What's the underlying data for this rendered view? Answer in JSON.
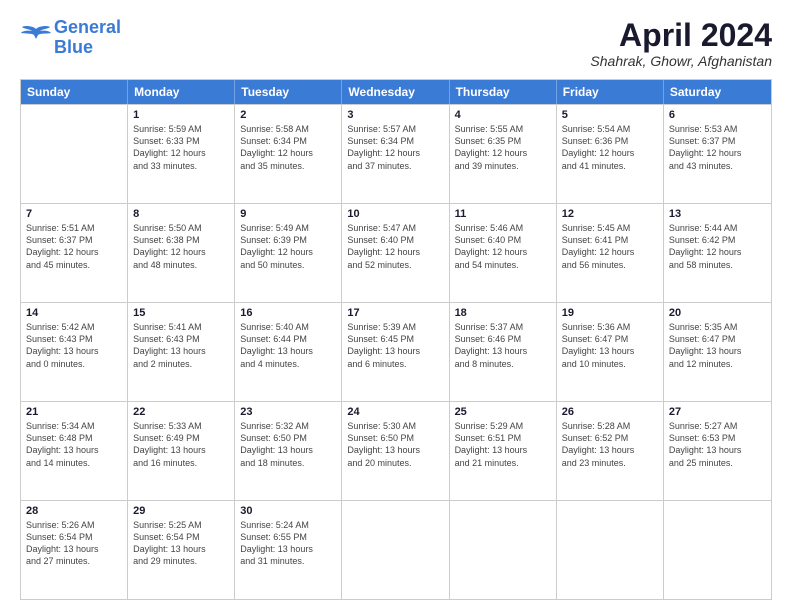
{
  "logo": {
    "line1": "General",
    "line2": "Blue"
  },
  "title": "April 2024",
  "subtitle": "Shahrak, Ghowr, Afghanistan",
  "days": [
    "Sunday",
    "Monday",
    "Tuesday",
    "Wednesday",
    "Thursday",
    "Friday",
    "Saturday"
  ],
  "weeks": [
    [
      {
        "day": "",
        "text": ""
      },
      {
        "day": "1",
        "text": "Sunrise: 5:59 AM\nSunset: 6:33 PM\nDaylight: 12 hours\nand 33 minutes."
      },
      {
        "day": "2",
        "text": "Sunrise: 5:58 AM\nSunset: 6:34 PM\nDaylight: 12 hours\nand 35 minutes."
      },
      {
        "day": "3",
        "text": "Sunrise: 5:57 AM\nSunset: 6:34 PM\nDaylight: 12 hours\nand 37 minutes."
      },
      {
        "day": "4",
        "text": "Sunrise: 5:55 AM\nSunset: 6:35 PM\nDaylight: 12 hours\nand 39 minutes."
      },
      {
        "day": "5",
        "text": "Sunrise: 5:54 AM\nSunset: 6:36 PM\nDaylight: 12 hours\nand 41 minutes."
      },
      {
        "day": "6",
        "text": "Sunrise: 5:53 AM\nSunset: 6:37 PM\nDaylight: 12 hours\nand 43 minutes."
      }
    ],
    [
      {
        "day": "7",
        "text": "Sunrise: 5:51 AM\nSunset: 6:37 PM\nDaylight: 12 hours\nand 45 minutes."
      },
      {
        "day": "8",
        "text": "Sunrise: 5:50 AM\nSunset: 6:38 PM\nDaylight: 12 hours\nand 48 minutes."
      },
      {
        "day": "9",
        "text": "Sunrise: 5:49 AM\nSunset: 6:39 PM\nDaylight: 12 hours\nand 50 minutes."
      },
      {
        "day": "10",
        "text": "Sunrise: 5:47 AM\nSunset: 6:40 PM\nDaylight: 12 hours\nand 52 minutes."
      },
      {
        "day": "11",
        "text": "Sunrise: 5:46 AM\nSunset: 6:40 PM\nDaylight: 12 hours\nand 54 minutes."
      },
      {
        "day": "12",
        "text": "Sunrise: 5:45 AM\nSunset: 6:41 PM\nDaylight: 12 hours\nand 56 minutes."
      },
      {
        "day": "13",
        "text": "Sunrise: 5:44 AM\nSunset: 6:42 PM\nDaylight: 12 hours\nand 58 minutes."
      }
    ],
    [
      {
        "day": "14",
        "text": "Sunrise: 5:42 AM\nSunset: 6:43 PM\nDaylight: 13 hours\nand 0 minutes."
      },
      {
        "day": "15",
        "text": "Sunrise: 5:41 AM\nSunset: 6:43 PM\nDaylight: 13 hours\nand 2 minutes."
      },
      {
        "day": "16",
        "text": "Sunrise: 5:40 AM\nSunset: 6:44 PM\nDaylight: 13 hours\nand 4 minutes."
      },
      {
        "day": "17",
        "text": "Sunrise: 5:39 AM\nSunset: 6:45 PM\nDaylight: 13 hours\nand 6 minutes."
      },
      {
        "day": "18",
        "text": "Sunrise: 5:37 AM\nSunset: 6:46 PM\nDaylight: 13 hours\nand 8 minutes."
      },
      {
        "day": "19",
        "text": "Sunrise: 5:36 AM\nSunset: 6:47 PM\nDaylight: 13 hours\nand 10 minutes."
      },
      {
        "day": "20",
        "text": "Sunrise: 5:35 AM\nSunset: 6:47 PM\nDaylight: 13 hours\nand 12 minutes."
      }
    ],
    [
      {
        "day": "21",
        "text": "Sunrise: 5:34 AM\nSunset: 6:48 PM\nDaylight: 13 hours\nand 14 minutes."
      },
      {
        "day": "22",
        "text": "Sunrise: 5:33 AM\nSunset: 6:49 PM\nDaylight: 13 hours\nand 16 minutes."
      },
      {
        "day": "23",
        "text": "Sunrise: 5:32 AM\nSunset: 6:50 PM\nDaylight: 13 hours\nand 18 minutes."
      },
      {
        "day": "24",
        "text": "Sunrise: 5:30 AM\nSunset: 6:50 PM\nDaylight: 13 hours\nand 20 minutes."
      },
      {
        "day": "25",
        "text": "Sunrise: 5:29 AM\nSunset: 6:51 PM\nDaylight: 13 hours\nand 21 minutes."
      },
      {
        "day": "26",
        "text": "Sunrise: 5:28 AM\nSunset: 6:52 PM\nDaylight: 13 hours\nand 23 minutes."
      },
      {
        "day": "27",
        "text": "Sunrise: 5:27 AM\nSunset: 6:53 PM\nDaylight: 13 hours\nand 25 minutes."
      }
    ],
    [
      {
        "day": "28",
        "text": "Sunrise: 5:26 AM\nSunset: 6:54 PM\nDaylight: 13 hours\nand 27 minutes."
      },
      {
        "day": "29",
        "text": "Sunrise: 5:25 AM\nSunset: 6:54 PM\nDaylight: 13 hours\nand 29 minutes."
      },
      {
        "day": "30",
        "text": "Sunrise: 5:24 AM\nSunset: 6:55 PM\nDaylight: 13 hours\nand 31 minutes."
      },
      {
        "day": "",
        "text": ""
      },
      {
        "day": "",
        "text": ""
      },
      {
        "day": "",
        "text": ""
      },
      {
        "day": "",
        "text": ""
      }
    ]
  ]
}
